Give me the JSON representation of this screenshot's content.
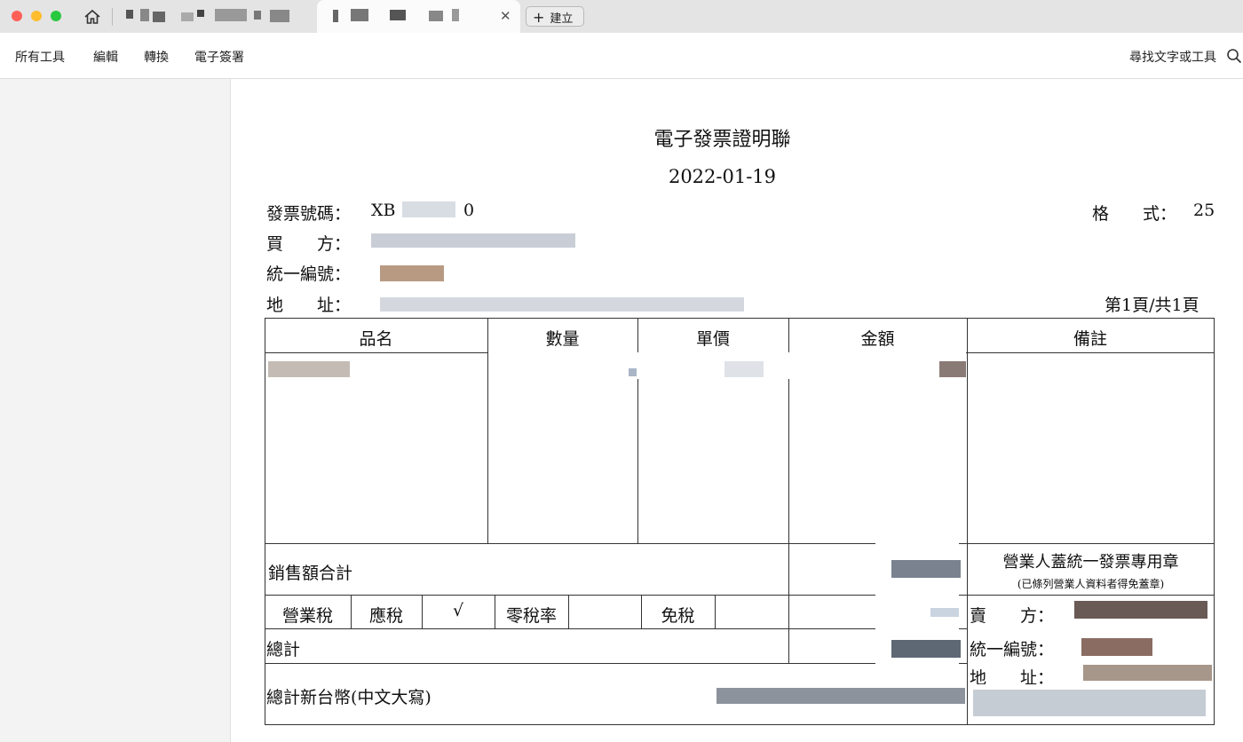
{
  "toolbar": {
    "new_tab_label": "建立"
  },
  "menu": {
    "items": [
      "所有工具",
      "編輯",
      "轉換",
      "電子簽署"
    ],
    "search_label": "尋找文字或工具"
  },
  "document": {
    "title": "電子發票證明聯",
    "date": "2022-01-19",
    "invoice_no_label": "發票號碼：",
    "invoice_no_prefix": "XB",
    "invoice_no_suffix": "0",
    "format_label": "格　　式：",
    "format_value": "25",
    "buyer_label": "買　　方：",
    "tax_id_label": "統一編號：",
    "address_label": "地　　址：",
    "page_label": "第1頁/共1頁",
    "table": {
      "headers": [
        "品名",
        "數量",
        "單價",
        "金額",
        "備註"
      ],
      "sales_total_label": "銷售額合計",
      "stamp_title": "營業人蓋統一發票專用章",
      "stamp_note": "(已條列營業人資料者得免蓋章)",
      "business_tax_label": "營業稅",
      "taxable_label": "應稅",
      "check_mark": "√",
      "zero_rate_label": "零稅率",
      "tax_free_label": "免稅",
      "seller_label": "賣　　方：",
      "seller_tax_id_label": "統一編號：",
      "seller_address_label": "地　　址：",
      "total_label": "總計",
      "total_chinese_label": "總計新台幣(中文大寫)"
    }
  },
  "colors": {
    "close_light": "#fe5f57",
    "minimize_light": "#febc2e",
    "zoom_light": "#28c840"
  }
}
